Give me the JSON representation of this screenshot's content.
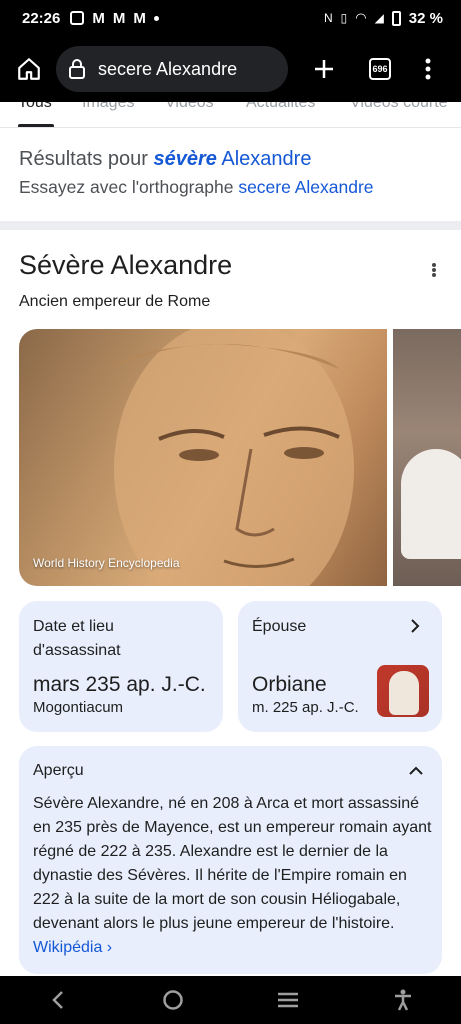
{
  "status": {
    "time": "22:26",
    "battery": "32 %"
  },
  "browser": {
    "url": "secere Alexandre",
    "tab_count": "696"
  },
  "search_tabs": [
    "Tous",
    "Images",
    "Vidéos",
    "Actualités",
    "Vidéos courte"
  ],
  "spelling": {
    "results_prefix": "Résultats pour",
    "corrected_word": "sévère",
    "corrected_rest": "Alexandre",
    "try_prefix": "Essayez avec l'orthographe",
    "original_query": "secere Alexandre"
  },
  "knowledge_panel": {
    "title": "Sévère Alexandre",
    "subtitle": "Ancien empereur de Rome",
    "image_credit": "World History Encyclopedia",
    "death_card": {
      "label": "Date et lieu d'assassinat",
      "value": "mars 235 ap. J.-C.",
      "sub": "Mogontiacum"
    },
    "spouse_card": {
      "label": "Épouse",
      "value": "Orbiane",
      "sub": "m. 225 ap. J.-C."
    },
    "overview": {
      "title": "Aperçu",
      "text": "Sévère Alexandre, né en 208 à Arca et mort assassiné en 235 près de Mayence, est un empereur romain ayant régné de 222 à 235. Alexandre est le dernier de la dynastie des Sévères. Il hérite de l'Empire romain en 222 à la suite de la mort de son cousin Héliogabale, devenant alors le plus jeune empereur de l'histoire.",
      "source_link": "Wikipédia ›"
    }
  },
  "colors": {
    "accent_blue": "#1558d6",
    "card_bg": "#e8eefc"
  }
}
